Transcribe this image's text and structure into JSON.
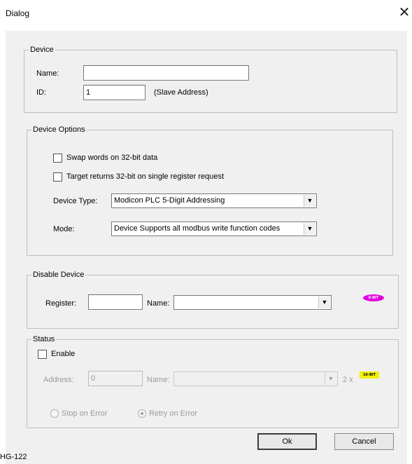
{
  "window": {
    "title": "Dialog",
    "close_glyph": "✕"
  },
  "device": {
    "legend": "Device",
    "name_label": "Name:",
    "name_value": "",
    "id_label": "ID:",
    "id_value": "1",
    "id_hint": "(Slave Address)"
  },
  "device_options": {
    "legend": "Device Options",
    "swap_words": {
      "label": "Swap words on 32-bit data",
      "checked": false
    },
    "target_returns": {
      "label": "Target returns 32-bit on single register request",
      "checked": false
    },
    "device_type_label": "Device Type:",
    "device_type_value": "Modicon PLC 5-Digit Addressing",
    "mode_label": "Mode:",
    "mode_value": "Device Supports all modbus write function codes"
  },
  "disable_device": {
    "legend": "Disable Device",
    "register_label": "Register:",
    "register_value": "",
    "name_label": "Name:",
    "name_value": "",
    "badge_text": "0-BIT",
    "badge_color": "#e000e0"
  },
  "status": {
    "legend": "Status",
    "enable": {
      "label": "Enable",
      "checked": false
    },
    "address_label": "Address:",
    "address_value": "0",
    "name_label": "Name:",
    "name_value": "",
    "multiplier": "2 x",
    "badge_text": "16-BIT",
    "badge_color": "#f0f000",
    "stop_on_error": {
      "label": "Stop on Error",
      "selected": false
    },
    "retry_on_error": {
      "label": "Retry on Error",
      "selected": true
    }
  },
  "buttons": {
    "ok": "Ok",
    "cancel": "Cancel"
  },
  "footer": {
    "id_tag": "HG-122"
  }
}
